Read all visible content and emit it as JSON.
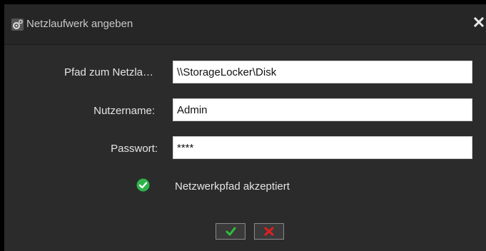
{
  "window": {
    "title": "Netzlaufwerk angeben",
    "icon": "gear-icon",
    "close_icon": "close-icon"
  },
  "form": {
    "path_label": "Pfad zum Netzla…",
    "path_value": "\\\\StorageLocker\\Disk",
    "username_label": "Nutzername:",
    "username_value": "Admin",
    "password_label": "Passwort:",
    "password_value": "****"
  },
  "status": {
    "icon": "check-circle-icon",
    "text": "Netzwerkpfad akzeptiert",
    "color": "#2db34a"
  },
  "buttons": {
    "confirm_icon": "checkmark-icon",
    "confirm_color": "#2fbf3a",
    "cancel_icon": "x-icon",
    "cancel_color": "#e02020"
  }
}
